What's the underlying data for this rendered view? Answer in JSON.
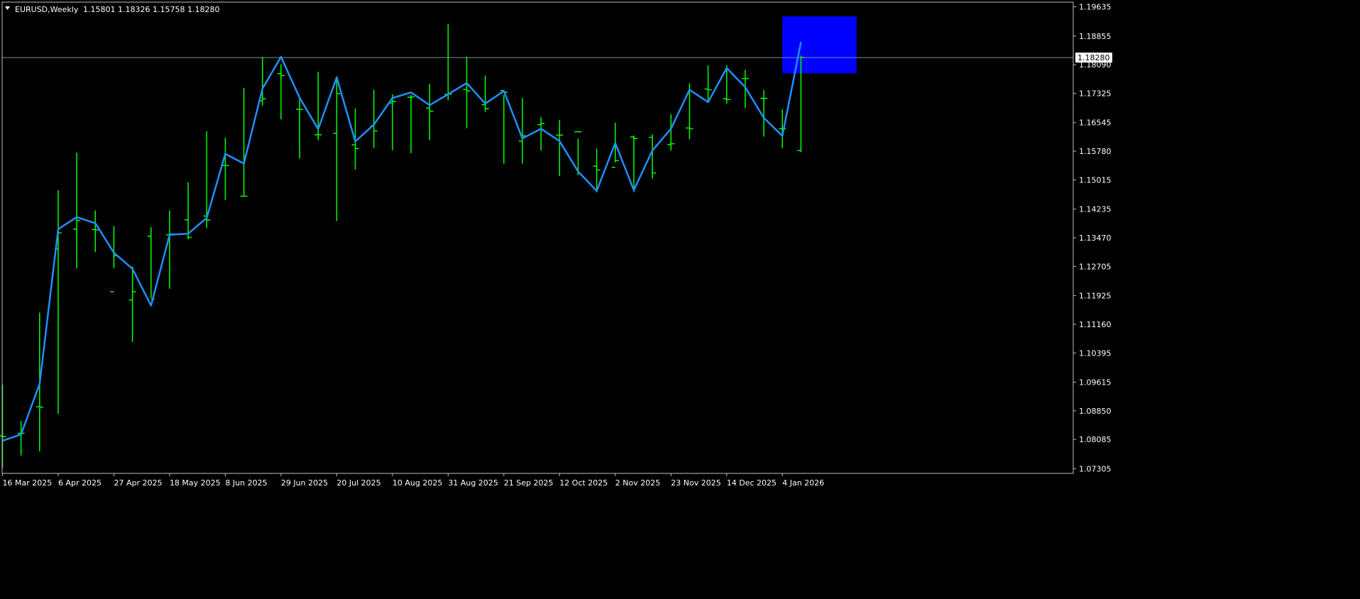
{
  "header": {
    "symbol": "EURUSD,Weekly",
    "ohlc": "1.15801 1.18326 1.15758 1.18280"
  },
  "colors": {
    "background": "#000000",
    "bars": "#00FF00",
    "line": "#1E90FF",
    "box": "#0000FF",
    "price_line": "#6F93A6",
    "axis": "#C0C0C0",
    "text": "#FFFFFF"
  },
  "chart_data": {
    "type": "line",
    "title": "EURUSD,Weekly",
    "y_ticks": [
      "1.19635",
      "1.18855",
      "1.18090",
      "1.17325",
      "1.16545",
      "1.15780",
      "1.15015",
      "1.14235",
      "1.13470",
      "1.12705",
      "1.11925",
      "1.11160",
      "1.10395",
      "1.09615",
      "1.08850",
      "1.08085",
      "1.07305"
    ],
    "x_ticks": [
      "16 Mar 2025",
      "6 Apr 2025",
      "27 Apr 2025",
      "18 May 2025",
      "8 Jun 2025",
      "29 Jun 2025",
      "20 Jul 2025",
      "10 Aug 2025",
      "31 Aug 2025",
      "21 Sep 2025",
      "12 Oct 2025",
      "2 Nov 2025",
      "23 Nov 2025",
      "14 Dec 2025",
      "4 Jan 2026"
    ],
    "ylim": [
      1.0718,
      1.1976
    ],
    "current_price": "1.18280",
    "highlight_box": {
      "price_top": 1.1938,
      "price_bottom": 1.1786,
      "start_week": 42,
      "end_week": 46
    },
    "series": [
      {
        "type": "ohlc",
        "dates": [
          "16 Mar 2025",
          "23 Mar 2025",
          "30 Mar 2025",
          "6 Apr 2025",
          "13 Apr 2025",
          "20 Apr 2025",
          "27 Apr 2025",
          "4 May 2025",
          "11 May 2025",
          "18 May 2025",
          "25 May 2025",
          "1 Jun 2025",
          "8 Jun 2025",
          "15 Jun 2025",
          "22 Jun 2025",
          "29 Jun 2025",
          "6 Jul 2025",
          "13 Jul 2025",
          "20 Jul 2025",
          "27 Jul 2025",
          "3 Aug 2025",
          "10 Aug 2025",
          "17 Aug 2025",
          "24 Aug 2025",
          "31 Aug 2025",
          "7 Sep 2025",
          "14 Sep 2025",
          "21 Sep 2025",
          "28 Sep 2025",
          "5 Oct 2025",
          "12 Oct 2025",
          "19 Oct 2025",
          "26 Oct 2025",
          "2 Nov 2025",
          "9 Nov 2025",
          "16 Nov 2025",
          "23 Nov 2025",
          "30 Nov 2025",
          "7 Dec 2025",
          "14 Dec 2025",
          "21 Dec 2025",
          "28 Dec 2025",
          "4 Jan 2026",
          "11 Jan 2026"
        ],
        "open": [
          1.0818,
          1.0825,
          1.0896,
          1.1317,
          1.137,
          1.1369,
          1.1203,
          1.1181,
          1.1351,
          1.1355,
          1.1395,
          1.1405,
          1.154,
          1.1458,
          1.1713,
          1.1785,
          1.169,
          1.1622,
          1.1626,
          1.1595,
          1.1645,
          1.1707,
          1.1722,
          1.1693,
          1.173,
          1.1743,
          1.1702,
          1.174,
          1.1605,
          1.1649,
          1.1621,
          1.163,
          1.1538,
          1.1535,
          1.1616,
          1.1615,
          1.1596,
          1.164,
          1.1744,
          1.1718,
          1.1772,
          1.1719,
          1.1638,
          1.158
        ],
        "high": [
          1.0955,
          1.0858,
          1.1147,
          1.1474,
          1.1574,
          1.142,
          1.1378,
          1.127,
          1.1375,
          1.142,
          1.1495,
          1.1631,
          1.1614,
          1.1747,
          1.1829,
          1.181,
          1.1721,
          1.179,
          1.1778,
          1.1692,
          1.1742,
          1.173,
          1.1728,
          1.1758,
          1.1918,
          1.183,
          1.178,
          1.1728,
          1.172,
          1.1669,
          1.1661,
          1.1612,
          1.1585,
          1.1654,
          1.162,
          1.1623,
          1.1677,
          1.1759,
          1.1807,
          1.1808,
          1.1795,
          1.1741,
          1.169,
          1.1833
        ],
        "low": [
          1.0733,
          1.0766,
          1.0777,
          1.0877,
          1.1265,
          1.1309,
          1.1266,
          1.1069,
          1.1186,
          1.1211,
          1.1343,
          1.1373,
          1.1448,
          1.1457,
          1.17,
          1.1663,
          1.1559,
          1.1608,
          1.1392,
          1.1529,
          1.1587,
          1.1581,
          1.1573,
          1.1608,
          1.1714,
          1.1639,
          1.1683,
          1.1545,
          1.1545,
          1.158,
          1.1512,
          1.1514,
          1.1468,
          1.1548,
          1.1469,
          1.1505,
          1.158,
          1.161,
          1.1707,
          1.1705,
          1.1694,
          1.1617,
          1.1586,
          1.1576
        ],
        "close": [
          1.0816,
          1.0825,
          1.0895,
          1.136,
          1.1393,
          1.1368,
          1.1299,
          1.1203,
          1.1183,
          1.1357,
          1.1348,
          1.1394,
          1.154,
          1.1458,
          1.1718,
          1.178,
          1.169,
          1.1622,
          1.1732,
          1.1585,
          1.1632,
          1.1711,
          1.1723,
          1.1685,
          1.173,
          1.1739,
          1.1692,
          1.1735,
          1.1619,
          1.1652,
          1.1621,
          1.163,
          1.1528,
          1.1553,
          1.1612,
          1.152,
          1.1598,
          1.1638,
          1.1742,
          1.1716,
          1.1772,
          1.1719,
          1.1638,
          1.1828
        ]
      },
      {
        "type": "line",
        "values": [
          1.0805,
          1.0822,
          1.0957,
          1.137,
          1.1402,
          1.1386,
          1.1307,
          1.1264,
          1.1166,
          1.1355,
          1.1358,
          1.14,
          1.1571,
          1.1545,
          1.1745,
          1.183,
          1.1721,
          1.1637,
          1.1775,
          1.1604,
          1.1649,
          1.172,
          1.1735,
          1.1701,
          1.173,
          1.176,
          1.1705,
          1.1739,
          1.1612,
          1.1638,
          1.1605,
          1.1524,
          1.1472,
          1.16,
          1.1474,
          1.158,
          1.1638,
          1.1742,
          1.1709,
          1.18,
          1.1749,
          1.1667,
          1.1619,
          1.1869
        ]
      }
    ]
  }
}
